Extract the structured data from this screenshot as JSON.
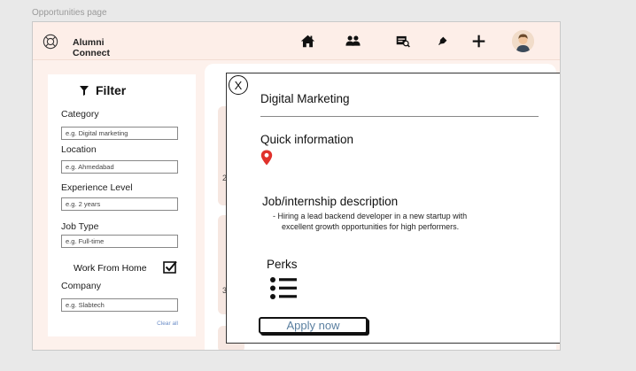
{
  "page_caption": "Opportunities page",
  "header": {
    "brand_line1": "Alumni",
    "brand_line2": "Connect",
    "nav_icons": [
      "home-icon",
      "community-icon",
      "jobs-search-icon",
      "notification-icon",
      "add-icon",
      "profile-avatar"
    ]
  },
  "filter": {
    "title": "Filter",
    "category_label": "Category",
    "category_placeholder": "e.g. Digital marketing",
    "location_label": "Location",
    "location_placeholder": "e.g. Ahmedabad",
    "experience_label": "Experience Level",
    "experience_placeholder": "e.g. 2 years",
    "jobtype_label": "Job Type",
    "jobtype_placeholder": "e.g. Full-time",
    "wfh_label": "Work From Home",
    "wfh_checked": true,
    "company_label": "Company",
    "company_placeholder": "e.g. Slabtech",
    "clear_label": "Clear all"
  },
  "background_cards": [
    {
      "line1": "2"
    },
    {
      "line1": "3"
    }
  ],
  "modal": {
    "close_glyph": "X",
    "title": "Digital Marketing",
    "quick_info_title": "Quick information",
    "description_title": "Job/internship description",
    "description_items": [
      "Hiring a lead backend developer in a new startup with excellent growth opportunities for high performers."
    ],
    "perks_title": "Perks",
    "apply_label": "Apply now"
  },
  "colors": {
    "header_bg": "#fdeee8",
    "content_bg": "#fdf1ec",
    "pin": "#e0312b",
    "apply_text": "#5a7fa0",
    "clear_link": "#6a8cc7"
  }
}
